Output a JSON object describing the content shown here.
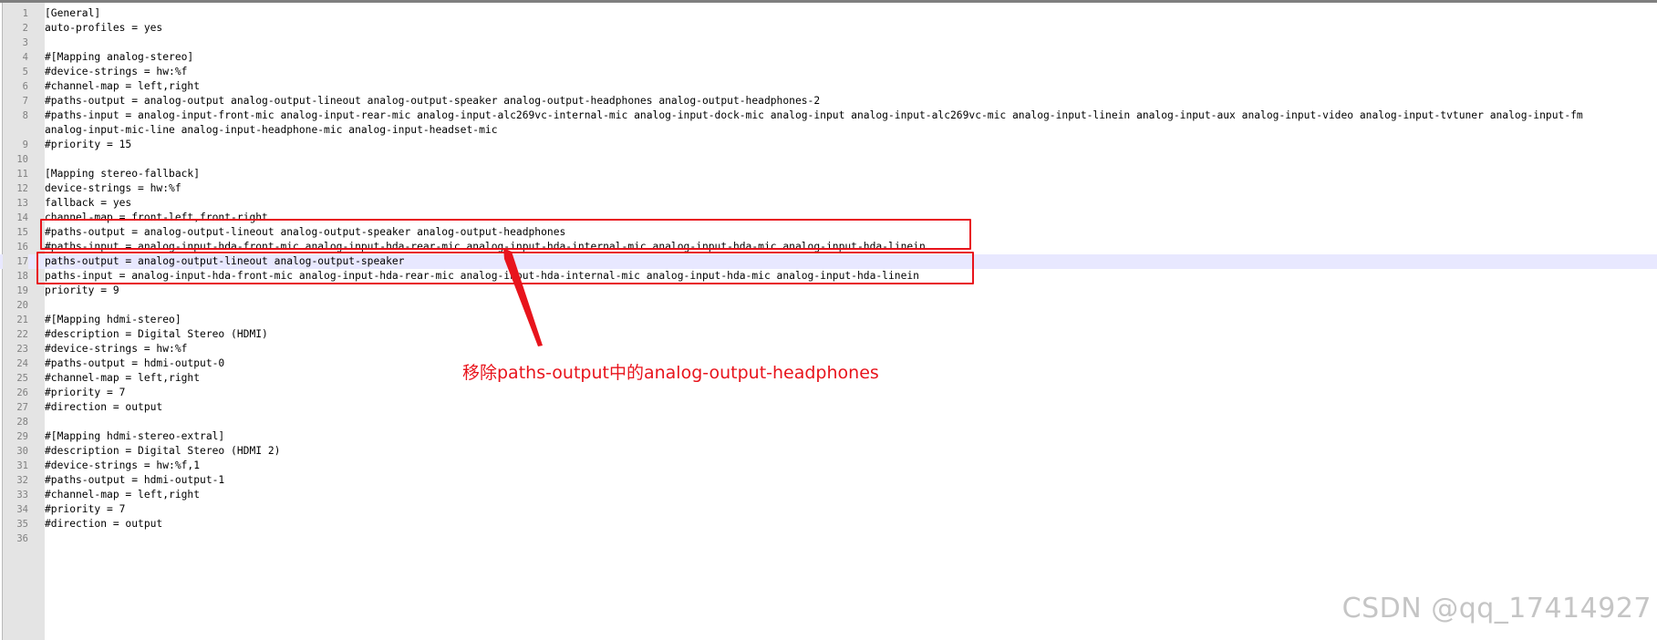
{
  "editor": {
    "current_line": 17,
    "lines": [
      {
        "n": "1",
        "text": "[General]"
      },
      {
        "n": "2",
        "text": "auto-profiles = yes"
      },
      {
        "n": "3",
        "text": ""
      },
      {
        "n": "4",
        "text": "#[Mapping analog-stereo]"
      },
      {
        "n": "5",
        "text": "#device-strings = hw:%f"
      },
      {
        "n": "6",
        "text": "#channel-map = left,right"
      },
      {
        "n": "7",
        "text": "#paths-output = analog-output analog-output-lineout analog-output-speaker analog-output-headphones analog-output-headphones-2"
      },
      {
        "n": "8",
        "text": "#paths-input = analog-input-front-mic analog-input-rear-mic analog-input-alc269vc-internal-mic analog-input-dock-mic analog-input analog-input-alc269vc-mic analog-input-linein analog-input-aux analog-input-video analog-input-tvtuner analog-input-fm",
        "wrap": "analog-input-mic-line analog-input-headphone-mic analog-input-headset-mic"
      },
      {
        "n": "9",
        "text": "#priority = 15"
      },
      {
        "n": "10",
        "text": ""
      },
      {
        "n": "11",
        "text": "[Mapping stereo-fallback]"
      },
      {
        "n": "12",
        "text": "device-strings = hw:%f"
      },
      {
        "n": "13",
        "text": "fallback = yes"
      },
      {
        "n": "14",
        "text": "channel-map = front-left,front-right"
      },
      {
        "n": "15",
        "text": "#paths-output = analog-output-lineout analog-output-speaker analog-output-headphones"
      },
      {
        "n": "16",
        "text": "#paths-input = analog-input-hda-front-mic analog-input-hda-rear-mic analog-input-hda-internal-mic analog-input-hda-mic analog-input-hda-linein"
      },
      {
        "n": "17",
        "text": "paths-output = analog-output-lineout analog-output-speaker"
      },
      {
        "n": "18",
        "text": "paths-input = analog-input-hda-front-mic analog-input-hda-rear-mic analog-input-hda-internal-mic analog-input-hda-mic analog-input-hda-linein"
      },
      {
        "n": "19",
        "text": "priority = 9"
      },
      {
        "n": "20",
        "text": ""
      },
      {
        "n": "21",
        "text": "#[Mapping hdmi-stereo]"
      },
      {
        "n": "22",
        "text": "#description = Digital Stereo (HDMI)"
      },
      {
        "n": "23",
        "text": "#device-strings = hw:%f"
      },
      {
        "n": "24",
        "text": "#paths-output = hdmi-output-0"
      },
      {
        "n": "25",
        "text": "#channel-map = left,right"
      },
      {
        "n": "26",
        "text": "#priority = 7"
      },
      {
        "n": "27",
        "text": "#direction = output"
      },
      {
        "n": "28",
        "text": ""
      },
      {
        "n": "29",
        "text": "#[Mapping hdmi-stereo-extral]"
      },
      {
        "n": "30",
        "text": "#description = Digital Stereo (HDMI 2)"
      },
      {
        "n": "31",
        "text": "#device-strings = hw:%f,1"
      },
      {
        "n": "32",
        "text": "#paths-output = hdmi-output-1"
      },
      {
        "n": "33",
        "text": "#channel-map = left,right"
      },
      {
        "n": "34",
        "text": "#priority = 7"
      },
      {
        "n": "35",
        "text": "#direction = output"
      },
      {
        "n": "36",
        "text": ""
      }
    ]
  },
  "annotation": {
    "note": "移除paths-output中的analog-output-headphones",
    "color": "#e8141c"
  },
  "watermark": "CSDN @qq_17414927"
}
